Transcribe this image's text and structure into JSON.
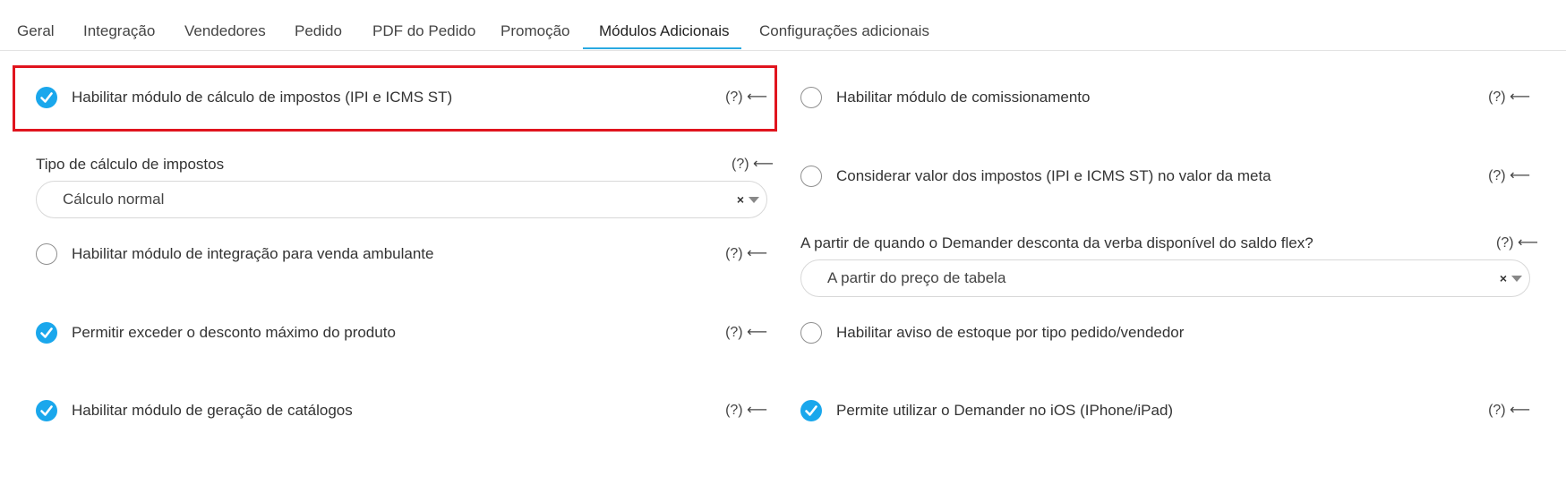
{
  "tabs": [
    {
      "label": "Geral",
      "active": false
    },
    {
      "label": "Integração",
      "active": false
    },
    {
      "label": "Vendedores",
      "active": false
    },
    {
      "label": "Pedido",
      "active": false
    },
    {
      "label": "PDF do Pedido",
      "active": false
    },
    {
      "label": "Promoção",
      "active": false
    },
    {
      "label": "Módulos Adicionais",
      "active": true
    },
    {
      "label": "Configurações adicionais",
      "active": false
    }
  ],
  "help_label": "(?) ⟵",
  "left": {
    "tax_module": {
      "label": "Habilitar módulo de cálculo de impostos (IPI e ICMS ST)",
      "checked": true
    },
    "tax_type": {
      "label": "Tipo de cálculo de impostos",
      "selected": "Cálculo normal",
      "clear": "×"
    },
    "traveling_sales": {
      "label": "Habilitar módulo de integração para venda ambulante",
      "checked": false
    },
    "exceed_discount": {
      "label": "Permitir exceder o desconto máximo do produto",
      "checked": true
    },
    "catalogs": {
      "label": "Habilitar módulo de geração de catálogos",
      "checked": true
    }
  },
  "right": {
    "commission": {
      "label": "Habilitar módulo de comissionamento",
      "checked": false
    },
    "tax_in_goal": {
      "label": "Considerar valor dos impostos (IPI e ICMS ST) no valor da meta",
      "checked": false
    },
    "flex_balance": {
      "label": "A partir de quando o Demander desconta da verba disponível do saldo flex?",
      "selected": "A partir do preço de tabela",
      "clear": "×"
    },
    "stock_warning": {
      "label": "Habilitar aviso de estoque por tipo pedido/vendedor",
      "checked": false
    },
    "ios": {
      "label": "Permite utilizar o Demander no iOS (IPhone/iPad)",
      "checked": true
    }
  },
  "colors": {
    "accent": "#1aa7ec",
    "highlight": "#e0141e",
    "tab_underline": "#29a9e1"
  }
}
